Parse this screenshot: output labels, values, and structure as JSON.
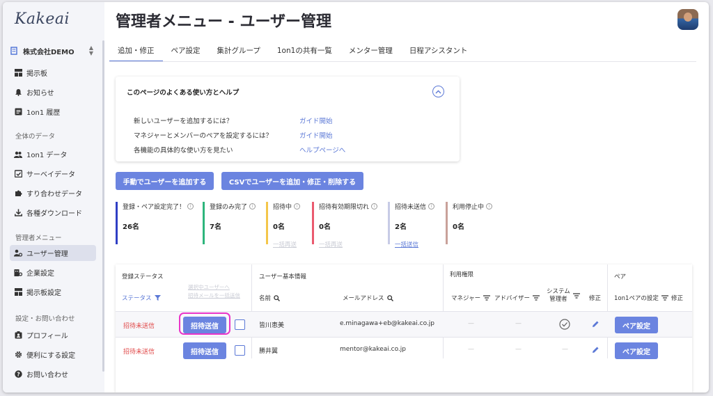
{
  "app": {
    "logo": "Kakeai"
  },
  "sidebar": {
    "company": "株式会社DEMO",
    "top_items": [
      {
        "label": "掲示板",
        "icon": "board-icon"
      },
      {
        "label": "お知らせ",
        "icon": "bell-icon"
      },
      {
        "label": "1on1 履歴",
        "icon": "history-icon"
      }
    ],
    "sections": [
      {
        "title": "全体のデータ",
        "items": [
          {
            "label": "1on1 データ",
            "icon": "people-icon"
          },
          {
            "label": "サーベイデータ",
            "icon": "survey-icon"
          },
          {
            "label": "すり合わせデータ",
            "icon": "puzzle-icon"
          },
          {
            "label": "各種ダウンロード",
            "icon": "download-icon"
          }
        ]
      },
      {
        "title": "管理者メニュー",
        "items": [
          {
            "label": "ユーザー管理",
            "icon": "user-settings-icon",
            "active": true
          },
          {
            "label": "企業設定",
            "icon": "building-icon"
          },
          {
            "label": "掲示板設定",
            "icon": "board-settings-icon"
          }
        ]
      },
      {
        "title": "設定・お問い合わせ",
        "items": [
          {
            "label": "プロフィール",
            "icon": "profile-icon"
          },
          {
            "label": "便利にする設定",
            "icon": "gear-icon"
          },
          {
            "label": "お問い合わせ",
            "icon": "help-icon"
          }
        ]
      }
    ]
  },
  "header": {
    "title": "管理者メニュー - ユーザー管理"
  },
  "tabs": [
    {
      "label": "追加・修正",
      "active": true
    },
    {
      "label": "ペア設定"
    },
    {
      "label": "集計グループ"
    },
    {
      "label": "1on1の共有一覧"
    },
    {
      "label": "メンター管理"
    },
    {
      "label": "日程アシスタント"
    }
  ],
  "help": {
    "title": "このページのよくある使い方とヘルプ",
    "rows": [
      {
        "question": "新しいユーザーを追加するには？",
        "link": "ガイド開始"
      },
      {
        "question": "マネジャーとメンバーのペアを設定するには？",
        "link": "ガイド開始"
      },
      {
        "question": "各機能の具体的な使い方を見たい",
        "link": "ヘルプページへ"
      }
    ]
  },
  "actions": {
    "add_manual": "手動でユーザーを追加する",
    "add_csv": "CSVでユーザーを追加・修正・削除する"
  },
  "stats": [
    {
      "label": "登録・ペア設定完了！",
      "value": "26名",
      "color": "#2f3fc4",
      "action": ""
    },
    {
      "label": "登録のみ完了",
      "value": "7名",
      "color": "#2db57c",
      "action": ""
    },
    {
      "label": "招待中",
      "value": "0名",
      "color": "#f4c64a",
      "action": "一括再送"
    },
    {
      "label": "招待有効期限切れ",
      "value": "0名",
      "color": "#ea5a6e",
      "action": "一括再送"
    },
    {
      "label": "招待未送信",
      "value": "2名",
      "color": "#c7cbe6",
      "action": "一括送信",
      "action_active": true
    },
    {
      "label": "利用停止中",
      "value": "0名",
      "color": "#c9a19a",
      "action": ""
    }
  ],
  "table": {
    "groups": {
      "status": "登録ステータス",
      "user": "ユーザー基本情報",
      "perm": "利用権限",
      "pair": "ペア"
    },
    "headers": {
      "status": "ステータス",
      "bulk_line1": "選択中ユーザーへ",
      "bulk_line2": "招待メールを一括送信",
      "name": "名前",
      "email": "メールアドレス",
      "manager": "マネジャー",
      "advisor": "アドバイザー",
      "sysadmin_line1": "システム",
      "sysadmin_line2": "管理者",
      "edit": "修正",
      "pair_setting": "1on1ペアの設定",
      "pair_edit": "修正"
    },
    "rows": [
      {
        "status": "招待未送信",
        "send_button": "招待送信",
        "name": "皆川恵美",
        "email": "e.minagawa+eb@kakeai.co.jp",
        "manager": "—",
        "advisor": "—",
        "sysadmin": true,
        "pair_button": "ペア設定"
      },
      {
        "status": "招待未送信",
        "send_button": "招待送信",
        "name": "勝井翼",
        "email": "mentor@kakeai.co.jp",
        "manager": "—",
        "advisor": "—",
        "sysadmin_dash": "—",
        "pair_button": "ペア設定"
      }
    ]
  },
  "colors": {
    "accent": "#6b84e0",
    "highlight": "#e935c9",
    "status_red": "#e04848"
  }
}
